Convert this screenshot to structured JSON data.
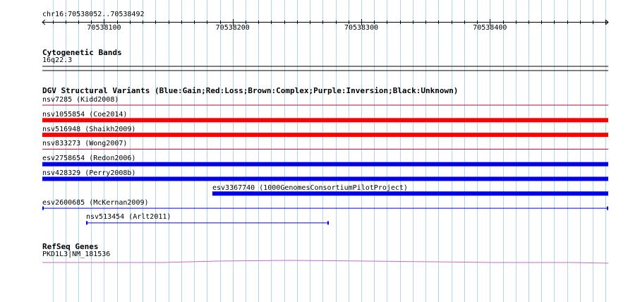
{
  "coords": {
    "label": "chr16:70538052..70538492",
    "start": 70538052,
    "end": 70538492
  },
  "ruler": {
    "ticks": [
      {
        "value": 70538100,
        "label": "70538100"
      },
      {
        "value": 70538200,
        "label": "70538200"
      },
      {
        "value": 70538300,
        "label": "70538300"
      },
      {
        "value": 70538400,
        "label": "70538400"
      }
    ]
  },
  "cyto": {
    "title": "Cytogenetic Bands",
    "band": "16q22.3"
  },
  "dgv": {
    "title": "DGV Structural Variants (Blue:Gain;Red:Loss;Brown:Complex;Purple:Inversion;Black:Unknown)",
    "variants": [
      {
        "label": "nsv7285 (Kidd2008)",
        "color": "#cc0033",
        "style": "thin",
        "start": 70538052,
        "end": 70538492
      },
      {
        "label": "nsv1055854 (Coe2014)",
        "color": "#ff0000",
        "style": "thick",
        "start": 70538052,
        "end": 70538492
      },
      {
        "label": "nsv516948 (Shaikh2009)",
        "color": "#ff0000",
        "style": "thick",
        "start": 70538052,
        "end": 70538492
      },
      {
        "label": "nsv833273 (Wong2007)",
        "color": "#cc0033",
        "style": "thin",
        "start": 70538052,
        "end": 70538492
      },
      {
        "label": "esv2758654 (Redon2006)",
        "color": "#0000ee",
        "style": "thick",
        "start": 70538052,
        "end": 70538492
      },
      {
        "label": "nsv428329 (Perry2008b)",
        "color": "#0000ee",
        "style": "thick",
        "start": 70538052,
        "end": 70538492
      },
      {
        "label": "esv3367740 (1000GenomesConsortiumPilotProject)",
        "color": "#0000ee",
        "style": "thick",
        "start": 70538184,
        "end": 70538492
      },
      {
        "label": "esv2600685 (McKernan2009)",
        "color": "#0000ee",
        "style": "bracket",
        "start": 70538052,
        "end": 70538492
      },
      {
        "label": "nsv513454 (Arlt2011)",
        "color": "#0000ee",
        "style": "bracket",
        "start": 70538086,
        "end": 70538275
      }
    ]
  },
  "refseq": {
    "title": "RefSeq Genes",
    "gene": "PKD1L3|NM_181536",
    "color": "#cc66cc"
  }
}
